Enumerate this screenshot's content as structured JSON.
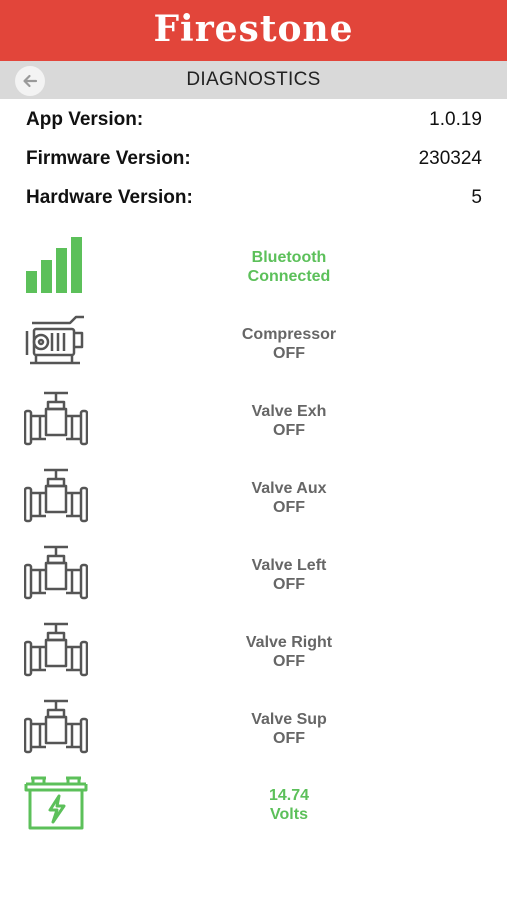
{
  "brand": {
    "logo_text": "Firestone",
    "color": "#e2453a"
  },
  "nav": {
    "title": "DIAGNOSTICS",
    "back_icon": "back-arrow-icon"
  },
  "info": [
    {
      "label": "App Version:",
      "value": "1.0.19"
    },
    {
      "label": "Firmware Version:",
      "value": "230324"
    },
    {
      "label": "Hardware Version:",
      "value": "5"
    }
  ],
  "diagnostics": [
    {
      "icon": "bluetooth-signal-icon",
      "line1": "Bluetooth",
      "line2": "Connected",
      "status_color": "#5cc05a"
    },
    {
      "icon": "compressor-icon",
      "line1": "Compressor",
      "line2": "OFF",
      "status_color": "#666666"
    },
    {
      "icon": "valve-icon",
      "line1": "Valve Exh",
      "line2": "OFF",
      "status_color": "#666666"
    },
    {
      "icon": "valve-icon",
      "line1": "Valve Aux",
      "line2": "OFF",
      "status_color": "#666666"
    },
    {
      "icon": "valve-icon",
      "line1": "Valve Left",
      "line2": "OFF",
      "status_color": "#666666"
    },
    {
      "icon": "valve-icon",
      "line1": "Valve Right",
      "line2": "OFF",
      "status_color": "#666666"
    },
    {
      "icon": "valve-icon",
      "line1": "Valve Sup",
      "line2": "OFF",
      "status_color": "#666666"
    },
    {
      "icon": "battery-icon",
      "line1": "14.74",
      "line2": "Volts",
      "status_color": "#5cc05a"
    }
  ]
}
